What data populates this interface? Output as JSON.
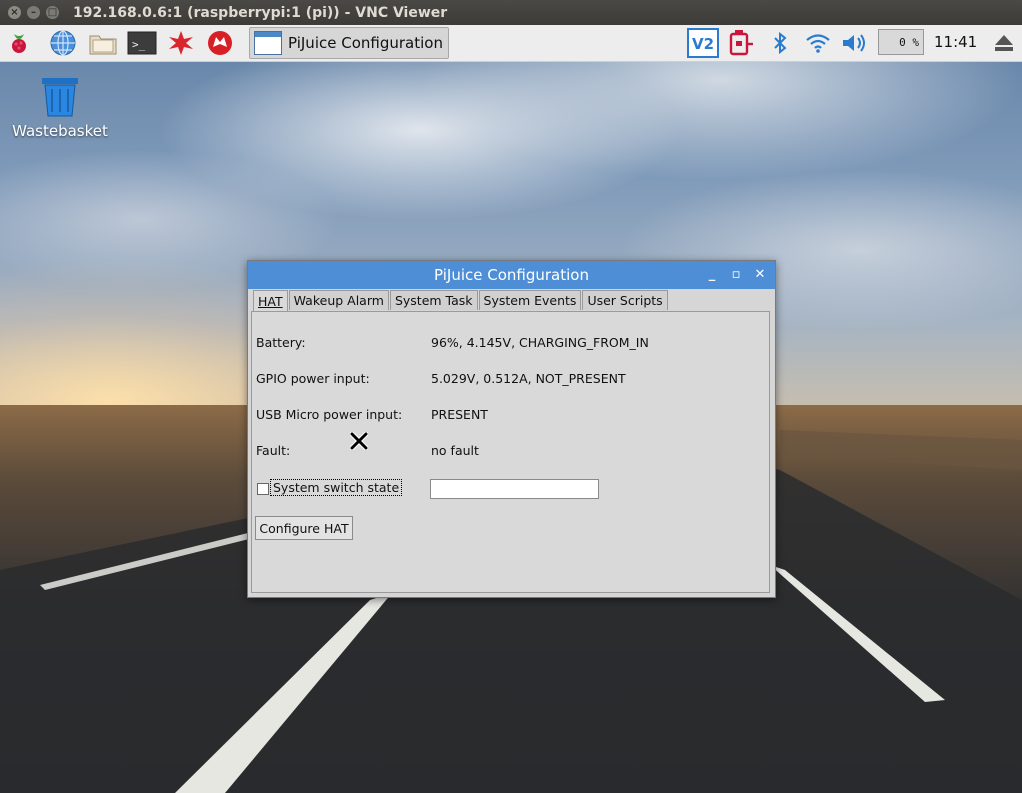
{
  "vnc": {
    "title": "192.168.0.6:1 (raspberrypi:1 (pi)) - VNC Viewer"
  },
  "taskbar": {
    "task_button_label": "PiJuice Configuration",
    "cpu": "0 %",
    "clock": "11:41"
  },
  "desktop": {
    "wastebasket_label": "Wastebasket"
  },
  "window": {
    "title": "PiJuice Configuration",
    "tabs": [
      {
        "label": "HAT",
        "active": true
      },
      {
        "label": "Wakeup Alarm"
      },
      {
        "label": "System Task"
      },
      {
        "label": "System Events"
      },
      {
        "label": "User Scripts"
      }
    ],
    "hat": {
      "battery_label": "Battery:",
      "battery_value": "96%, 4.145V, CHARGING_FROM_IN",
      "gpio_label": "GPIO power input:",
      "gpio_value": "5.029V, 0.512A, NOT_PRESENT",
      "usb_label": "USB Micro power input:",
      "usb_value": "PRESENT",
      "fault_label": "Fault:",
      "fault_value": "no fault",
      "switch_label": "System switch state",
      "switch_checked": false,
      "switch_value": "",
      "configure_button": "Configure HAT"
    }
  },
  "colors": {
    "titlebar_blue": "#4d8ed6",
    "panel_gray": "#d9d9d9"
  }
}
